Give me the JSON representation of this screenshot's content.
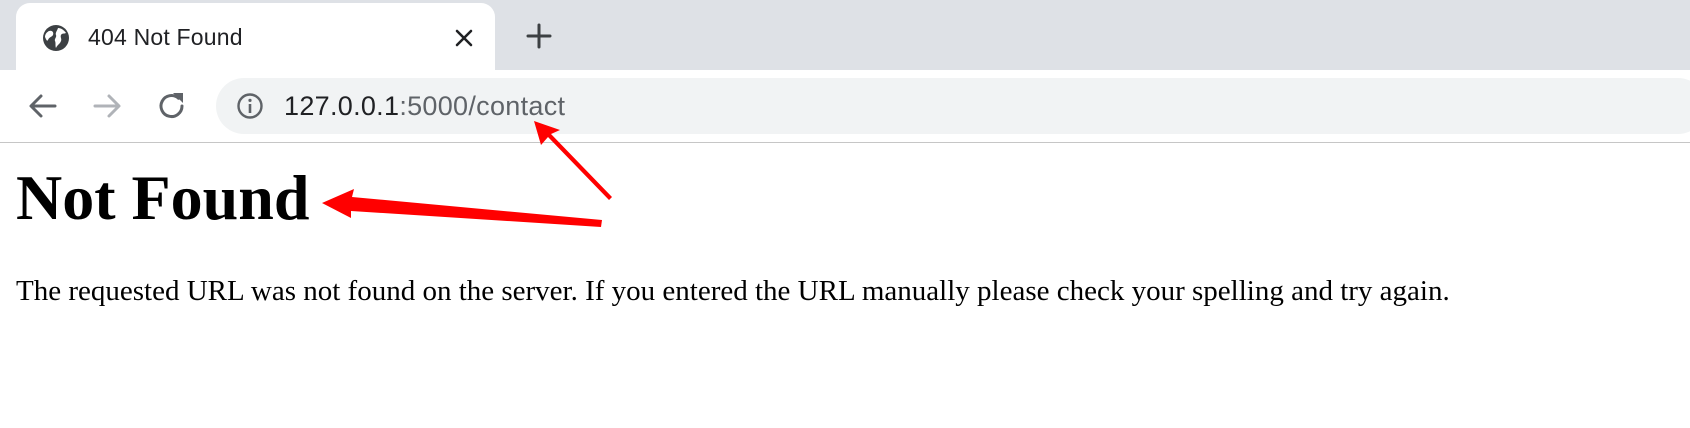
{
  "browser": {
    "tab": {
      "title": "404 Not Found",
      "icon": "globe-icon",
      "close_icon": "close-icon"
    },
    "new_tab_icon": "plus-icon",
    "nav": {
      "back_icon": "back-arrow-icon",
      "forward_icon": "forward-arrow-icon",
      "reload_icon": "reload-icon"
    },
    "omnibox": {
      "security_icon": "info-icon",
      "url_host": "127.0.0.1",
      "url_rest": ":5000/contact"
    }
  },
  "page": {
    "heading": "Not Found",
    "message": "The requested URL was not found on the server. If you entered the URL manually please check your spelling and try again."
  },
  "annotations": {
    "color": "#ff0000",
    "arrows": [
      "arrow-to-url",
      "arrow-to-heading"
    ]
  },
  "colors": {
    "tabstrip": "#dee1e6",
    "omnibox": "#f1f3f4",
    "text_dark": "#202124",
    "text_muted": "#5f6368"
  }
}
